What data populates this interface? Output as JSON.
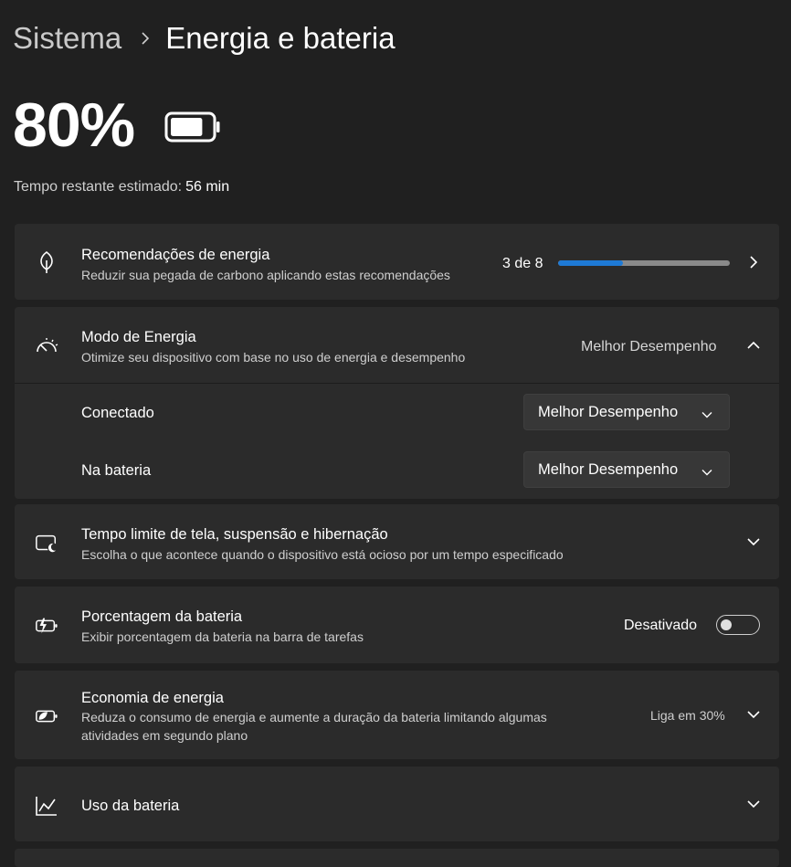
{
  "breadcrumb": {
    "parent": "Sistema",
    "current": "Energia e bateria"
  },
  "battery": {
    "percent_label": "80%",
    "level": 0.8,
    "remaining_label": "Tempo restante estimado:",
    "remaining_value": "56 min"
  },
  "recommendations": {
    "title": "Recomendações de energia",
    "subtitle": "Reduzir sua pegada de carbono aplicando estas recomendações",
    "count_label": "3 de 8",
    "progress": 0.375,
    "accent": "#1e7ad6",
    "icon": "leaf-icon"
  },
  "power_mode": {
    "title": "Modo de Energia",
    "subtitle": "Otimize seu dispositivo com base no uso de energia e desempenho",
    "current_value": "Melhor Desempenho",
    "icon": "gauge-icon",
    "plugged_label": "Conectado",
    "plugged_value": "Melhor Desempenho",
    "battery_label": "Na bateria",
    "battery_value": "Melhor Desempenho"
  },
  "screen_sleep": {
    "title": "Tempo limite de tela, suspensão e hibernação",
    "subtitle": "Escolha o que acontece quando o dispositivo está ocioso por um tempo especificado",
    "icon": "screen-sleep-icon"
  },
  "battery_percentage": {
    "title": "Porcentagem da bateria",
    "subtitle": "Exibir porcentagem da bateria na barra de tarefas",
    "state_label": "Desativado",
    "enabled": false,
    "icon": "battery-charging-icon"
  },
  "energy_saver": {
    "title": "Economia de energia",
    "subtitle_line1": "Reduza o consumo de energia e aumente a duração da bateria limitando algumas",
    "subtitle_line2": "atividades em segundo plano",
    "status": "Liga em 30%",
    "icon": "energy-saver-icon"
  },
  "battery_usage": {
    "title": "Uso da bateria",
    "icon": "chart-line-icon"
  }
}
